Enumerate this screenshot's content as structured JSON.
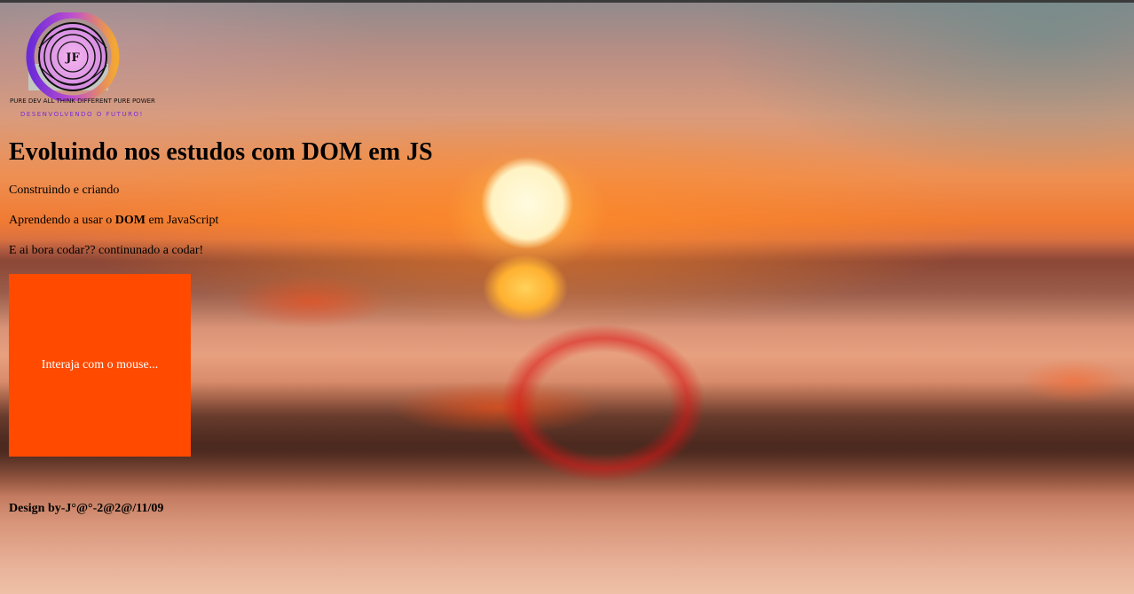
{
  "logo": {
    "initials": "JF",
    "tagline": "PURE DEV ALL THINK DIFFERENT PURE POWER",
    "subtitle": "DESENVOLVENDO O FUTURO!",
    "ring_gradient": [
      "#7a2bd6",
      "#f2a23a"
    ]
  },
  "heading": "Evoluindo nos estudos com DOM em JS",
  "paragraphs": {
    "p1": "Construindo e criando",
    "p2_prefix": "Aprendendo a usar o ",
    "p2_bold": "DOM",
    "p2_suffix": " em JavaScript",
    "p3": "E ai bora codar?? continunado a codar!"
  },
  "interactive_box": {
    "label": "Interaja com o mouse...",
    "color": "#ff4a00"
  },
  "footer": "Design by-J°@°-2@2@/11/09",
  "background": {
    "description_colors": [
      "#8f8a8c",
      "#ee8f52",
      "#fff3c4",
      "#8a4d3c",
      "#eec0a6"
    ]
  }
}
